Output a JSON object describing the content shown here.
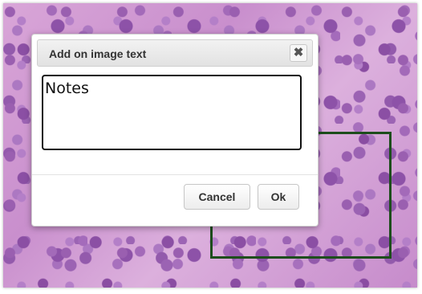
{
  "dialog": {
    "title": "Add on image text",
    "close_label": "✖",
    "notes_value": "Notes",
    "cancel_label": "Cancel",
    "ok_label": "Ok"
  },
  "colors": {
    "annotation_border": "#1d4d1c",
    "tissue_base": "#d9a6d8"
  },
  "icons": {
    "close": "close-icon"
  }
}
